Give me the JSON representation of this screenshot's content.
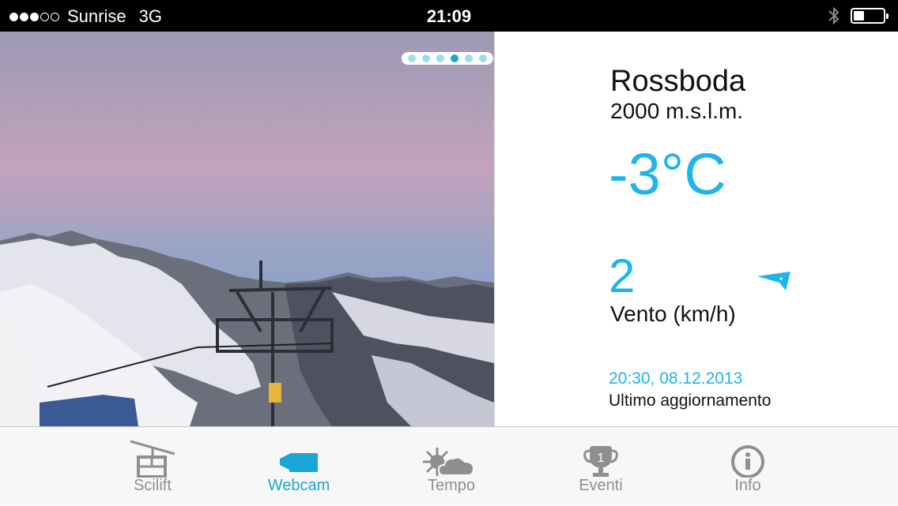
{
  "status_bar": {
    "carrier": "Sunrise",
    "network": "3G",
    "signal_bars": 3,
    "signal_total": 5,
    "time": "21:09",
    "battery_level": 0.35
  },
  "webcam": {
    "page_count": 6,
    "active_page": 3
  },
  "weather": {
    "location": "Rossboda",
    "altitude": "2000 m.s.l.m.",
    "temperature": "-3°C",
    "wind_speed": "2",
    "wind_label": "Vento (km/h)",
    "updated_time": "20:30, 08.12.2013",
    "updated_label": "Ultimo aggiornamento"
  },
  "tabs": [
    {
      "label": "Scilift",
      "icon": "cable-car-icon"
    },
    {
      "label": "Webcam",
      "icon": "camera-icon"
    },
    {
      "label": "Tempo",
      "icon": "sun-cloud-icon"
    },
    {
      "label": "Eventi",
      "icon": "trophy-icon",
      "badge": "1"
    },
    {
      "label": "Info",
      "icon": "info-icon"
    }
  ],
  "active_tab": 1,
  "colors": {
    "accent": "#1fb4ea",
    "inactive": "#8f8f8f"
  }
}
